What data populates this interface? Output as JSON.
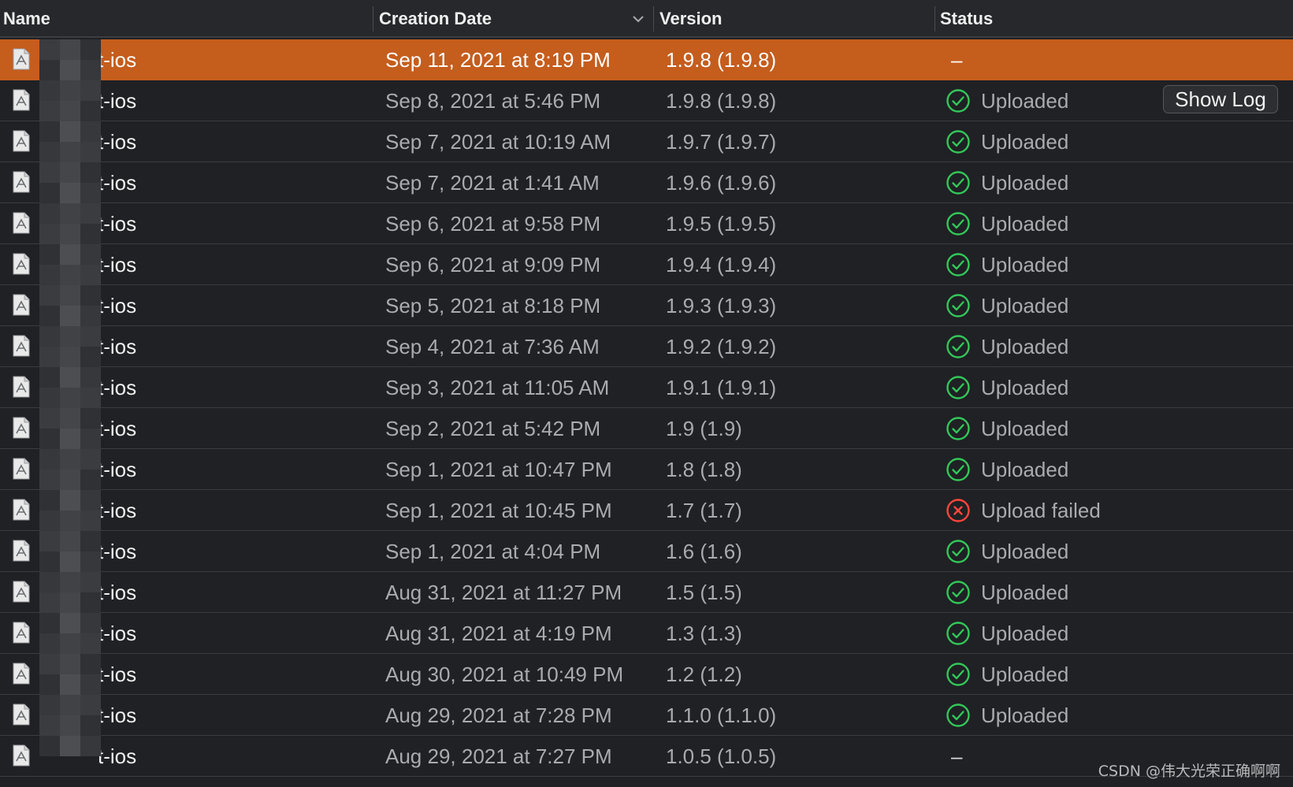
{
  "columns": {
    "name": "Name",
    "creation_date": "Creation Date",
    "version": "Version",
    "status": "Status"
  },
  "rows": [
    {
      "name": "t-ios",
      "date": "Sep 11, 2021 at 8:19 PM",
      "version": "1.9.8 (1.9.8)",
      "status": "",
      "state": "none",
      "selected": true
    },
    {
      "name": "t-ios",
      "date": "Sep 8, 2021 at 5:46 PM",
      "version": "1.9.8 (1.9.8)",
      "status": "Uploaded",
      "state": "ok"
    },
    {
      "name": "t-ios",
      "date": "Sep 7, 2021 at 10:19 AM",
      "version": "1.9.7 (1.9.7)",
      "status": "Uploaded",
      "state": "ok"
    },
    {
      "name": "t-ios",
      "date": "Sep 7, 2021 at 1:41 AM",
      "version": "1.9.6 (1.9.6)",
      "status": "Uploaded",
      "state": "ok"
    },
    {
      "name": "t-ios",
      "date": "Sep 6, 2021 at 9:58 PM",
      "version": "1.9.5 (1.9.5)",
      "status": "Uploaded",
      "state": "ok"
    },
    {
      "name": "t-ios",
      "date": "Sep 6, 2021 at 9:09 PM",
      "version": "1.9.4 (1.9.4)",
      "status": "Uploaded",
      "state": "ok"
    },
    {
      "name": "t-ios",
      "date": "Sep 5, 2021 at 8:18 PM",
      "version": "1.9.3 (1.9.3)",
      "status": "Uploaded",
      "state": "ok"
    },
    {
      "name": "t-ios",
      "date": "Sep 4, 2021 at 7:36 AM",
      "version": "1.9.2 (1.9.2)",
      "status": "Uploaded",
      "state": "ok"
    },
    {
      "name": "t-ios",
      "date": "Sep 3, 2021 at 11:05 AM",
      "version": "1.9.1 (1.9.1)",
      "status": "Uploaded",
      "state": "ok"
    },
    {
      "name": "t-ios",
      "date": "Sep 2, 2021 at 5:42 PM",
      "version": "1.9 (1.9)",
      "status": "Uploaded",
      "state": "ok"
    },
    {
      "name": "t-ios",
      "date": "Sep 1, 2021 at 10:47 PM",
      "version": "1.8 (1.8)",
      "status": "Uploaded",
      "state": "ok"
    },
    {
      "name": "t-ios",
      "date": "Sep 1, 2021 at 10:45 PM",
      "version": "1.7 (1.7)",
      "status": "Upload failed",
      "state": "failed"
    },
    {
      "name": "t-ios",
      "date": "Sep 1, 2021 at 4:04 PM",
      "version": "1.6 (1.6)",
      "status": "Uploaded",
      "state": "ok"
    },
    {
      "name": "t-ios",
      "date": "Aug 31, 2021 at 11:27 PM",
      "version": "1.5 (1.5)",
      "status": "Uploaded",
      "state": "ok"
    },
    {
      "name": "t-ios",
      "date": "Aug 31, 2021 at 4:19 PM",
      "version": "1.3 (1.3)",
      "status": "Uploaded",
      "state": "ok"
    },
    {
      "name": "t-ios",
      "date": "Aug 30, 2021 at 10:49 PM",
      "version": "1.2 (1.2)",
      "status": "Uploaded",
      "state": "ok"
    },
    {
      "name": "t-ios",
      "date": "Aug 29, 2021 at 7:28 PM",
      "version": "1.1.0 (1.1.0)",
      "status": "Uploaded",
      "state": "ok"
    },
    {
      "name": "t-ios",
      "date": "Aug 29, 2021 at 7:27 PM",
      "version": "1.0.5 (1.0.5)",
      "status": "",
      "state": "none"
    }
  ],
  "dash": "–",
  "show_log_label": "Show Log",
  "watermark": "CSDN @伟大光荣正确啊啊",
  "colors": {
    "selection": "#c55d1d",
    "success": "#33c759",
    "failure": "#ff453a"
  },
  "icons": {
    "file": "archive-file-icon",
    "sort": "chevron-down-icon",
    "ok": "checkmark-circle-icon",
    "failed": "xmark-circle-icon"
  }
}
